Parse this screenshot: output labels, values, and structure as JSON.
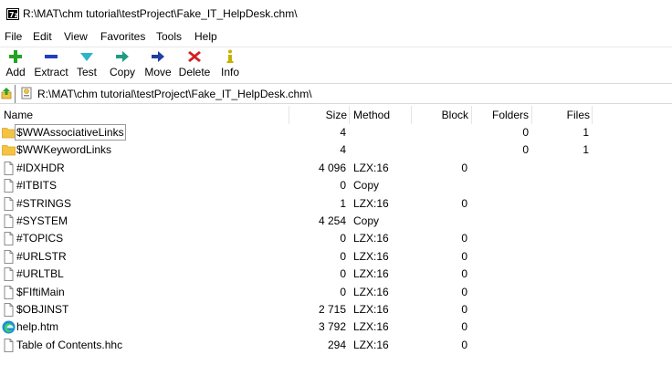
{
  "window": {
    "title": "R:\\MAT\\chm tutorial\\testProject\\Fake_IT_HelpDesk.chm\\"
  },
  "menu": [
    "File",
    "Edit",
    "View",
    "Favorites",
    "Tools",
    "Help"
  ],
  "toolbar": {
    "add": "Add",
    "extract": "Extract",
    "test": "Test",
    "copy": "Copy",
    "move": "Move",
    "delete": "Delete",
    "info": "Info"
  },
  "address": {
    "path": "R:\\MAT\\chm tutorial\\testProject\\Fake_IT_HelpDesk.chm\\"
  },
  "columns": {
    "name": "Name",
    "size": "Size",
    "method": "Method",
    "block": "Block",
    "folders": "Folders",
    "files": "Files"
  },
  "colors": {
    "folder": "#f5c342",
    "add": "#22a322",
    "extract": "#1f3fbf",
    "test": "#2bb5c9",
    "copy": "#1e9c84",
    "move": "#1f3f9f",
    "delete": "#d42020",
    "info": "#c9b000",
    "edge": "#1a8fd8"
  },
  "rows": [
    {
      "icon": "folder-icon",
      "name": "$WWAssociativeLinks",
      "size": "4",
      "method": "",
      "block": "",
      "folders": "0",
      "files": "1"
    },
    {
      "icon": "folder-icon",
      "name": "$WWKeywordLinks",
      "size": "4",
      "method": "",
      "block": "",
      "folders": "0",
      "files": "1"
    },
    {
      "icon": "file-icon",
      "name": "#IDXHDR",
      "size": "4 096",
      "method": "LZX:16",
      "block": "0",
      "folders": "",
      "files": ""
    },
    {
      "icon": "file-icon",
      "name": "#ITBITS",
      "size": "0",
      "method": "Copy",
      "block": "",
      "folders": "",
      "files": ""
    },
    {
      "icon": "file-icon",
      "name": "#STRINGS",
      "size": "1",
      "method": "LZX:16",
      "block": "0",
      "folders": "",
      "files": ""
    },
    {
      "icon": "file-icon",
      "name": "#SYSTEM",
      "size": "4 254",
      "method": "Copy",
      "block": "",
      "folders": "",
      "files": ""
    },
    {
      "icon": "file-icon",
      "name": "#TOPICS",
      "size": "0",
      "method": "LZX:16",
      "block": "0",
      "folders": "",
      "files": ""
    },
    {
      "icon": "file-icon",
      "name": "#URLSTR",
      "size": "0",
      "method": "LZX:16",
      "block": "0",
      "folders": "",
      "files": ""
    },
    {
      "icon": "file-icon",
      "name": "#URLTBL",
      "size": "0",
      "method": "LZX:16",
      "block": "0",
      "folders": "",
      "files": ""
    },
    {
      "icon": "file-icon",
      "name": "$FIftiMain",
      "size": "0",
      "method": "LZX:16",
      "block": "0",
      "folders": "",
      "files": ""
    },
    {
      "icon": "file-icon",
      "name": "$OBJINST",
      "size": "2 715",
      "method": "LZX:16",
      "block": "0",
      "folders": "",
      "files": ""
    },
    {
      "icon": "edge-icon",
      "name": "help.htm",
      "size": "3 792",
      "method": "LZX:16",
      "block": "0",
      "folders": "",
      "files": ""
    },
    {
      "icon": "file-icon",
      "name": "Table of Contents.hhc",
      "size": "294",
      "method": "LZX:16",
      "block": "0",
      "folders": "",
      "files": ""
    }
  ]
}
